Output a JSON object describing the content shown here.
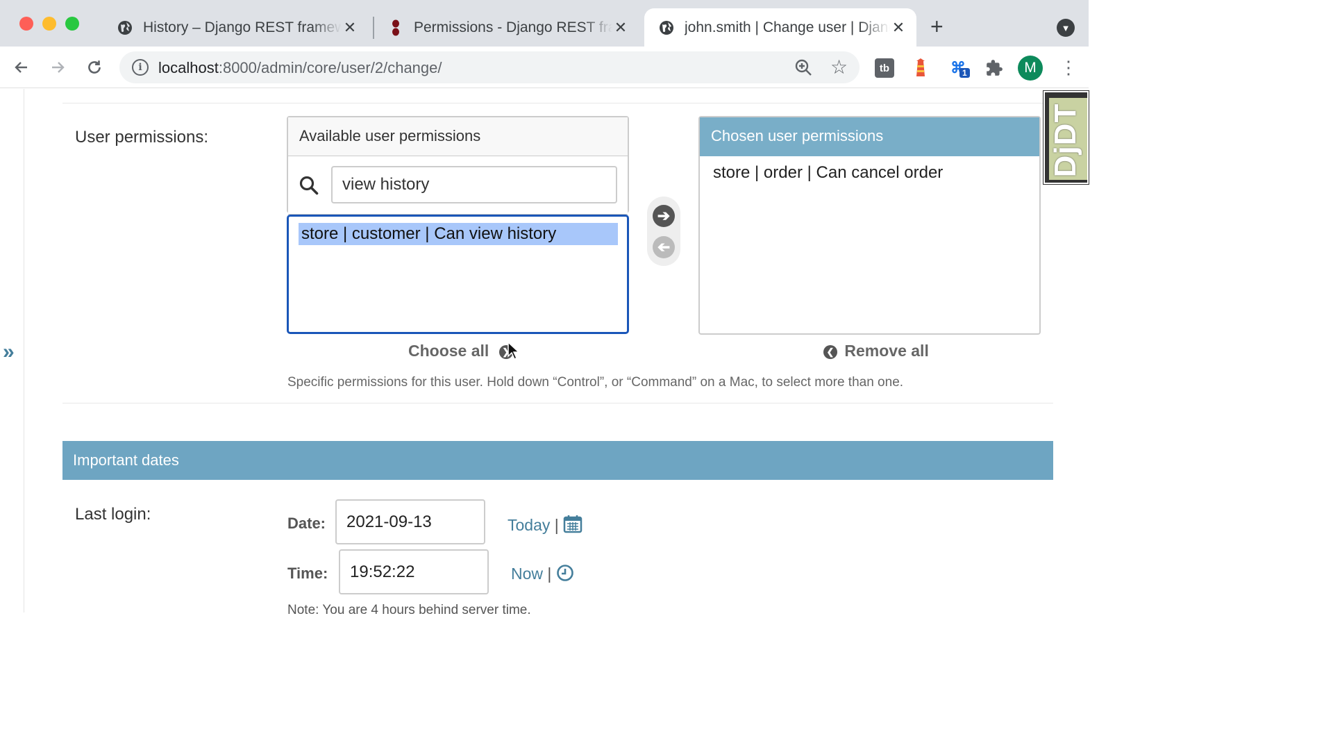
{
  "browser": {
    "tabs": [
      {
        "title": "History – Django REST framework",
        "favicon": "globe-icon",
        "active": false
      },
      {
        "title": "Permissions - Django REST framework",
        "favicon": "drf-icon",
        "active": false
      },
      {
        "title": "john.smith | Change user | Django site admin",
        "favicon": "globe-icon",
        "active": true
      }
    ],
    "url_host": "localhost",
    "url_rest": ":8000/admin/core/user/2/change/",
    "extension_badge": "1",
    "profile_initial": "M"
  },
  "permissions": {
    "label": "User permissions:",
    "available_title": "Available user permissions",
    "filter_value": "view history",
    "available_items": [
      "store | customer | Can view history"
    ],
    "chosen_title": "Chosen user permissions",
    "chosen_items": [
      "store | order | Can cancel order"
    ],
    "choose_all": "Choose all",
    "remove_all": "Remove all",
    "help_text": "Specific permissions for this user. Hold down “Control”, or “Command” on a Mac, to select more than one."
  },
  "important_dates": {
    "header": "Important dates",
    "last_login_label": "Last login:",
    "date_label": "Date:",
    "date_value": "2021-09-13",
    "today_link": "Today",
    "time_label": "Time:",
    "time_value": "19:52:22",
    "now_link": "Now",
    "separator": "|",
    "note": "Note: You are 4 hours behind server time."
  },
  "djdt": {
    "label": "DjDT"
  },
  "colors": {
    "accent": "#79aec8",
    "module_header": "#6ea5c2",
    "link": "#447e9b",
    "selection": "#a8c7fa",
    "focus_border": "#1a56b8"
  }
}
